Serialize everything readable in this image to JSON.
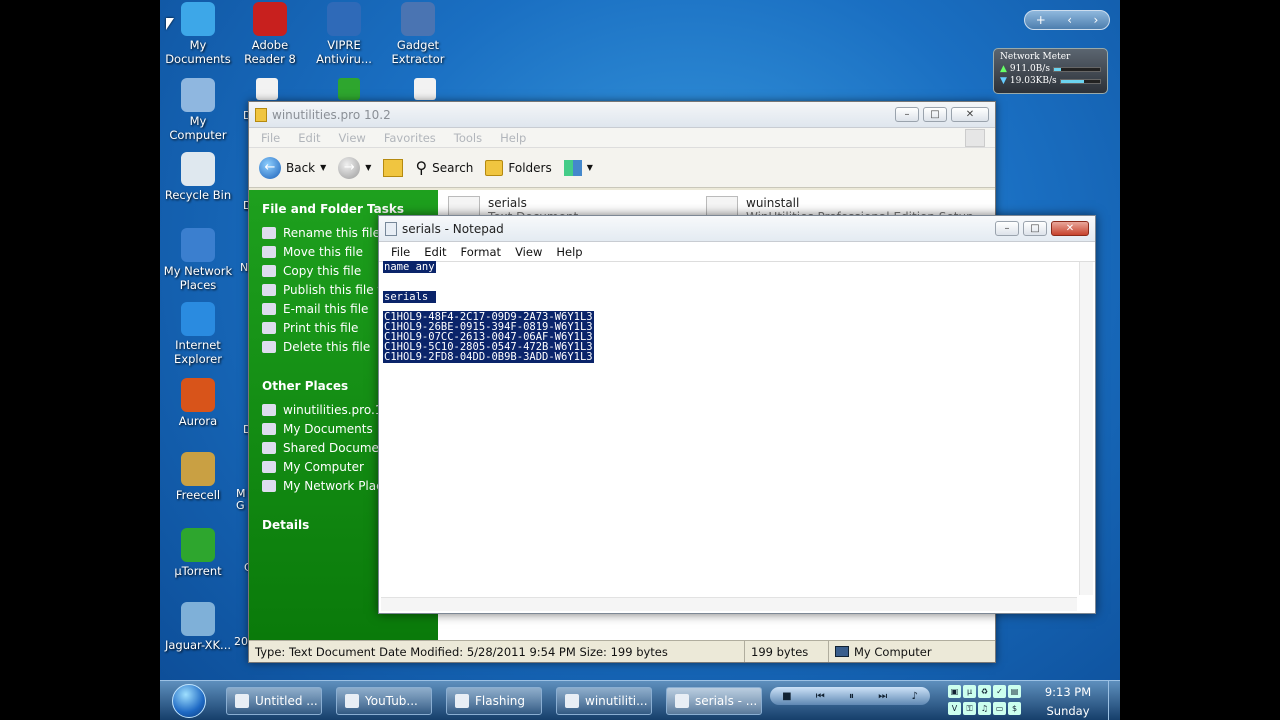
{
  "desktop": {
    "icons": [
      {
        "name": "my-documents",
        "label": "My\nDocuments",
        "color": "#3da7e8"
      },
      {
        "name": "adobe-reader",
        "label": "Adobe\nReader 8",
        "color": "#c8201e"
      },
      {
        "name": "vipre",
        "label": "VIPRE\nAntiviru...",
        "color": "#2f6ab8"
      },
      {
        "name": "gadget-extractor",
        "label": "Gadget\nExtractor",
        "color": "#4a74b2"
      },
      {
        "name": "my-computer",
        "label": "My Computer",
        "color": "#8fb7e0"
      },
      {
        "name": "recycle-bin",
        "label": "Recycle Bin",
        "color": "#dfe8ef"
      },
      {
        "name": "my-network-places",
        "label": "My Network\nPlaces",
        "color": "#3b7fcf"
      },
      {
        "name": "internet-explorer",
        "label": "Internet\nExplorer",
        "color": "#2a8be0"
      },
      {
        "name": "aurora",
        "label": "Aurora",
        "color": "#d8541a"
      },
      {
        "name": "freecell",
        "label": "Freecell",
        "color": "#c9a043"
      },
      {
        "name": "utorrent",
        "label": "µTorrent",
        "color": "#2ea62e"
      },
      {
        "name": "jaguar",
        "label": "Jaguar-XK...",
        "color": "#7fb0d8"
      }
    ],
    "partial_labels": [
      "D",
      "D",
      "D",
      "N",
      "D",
      "M\nG",
      "C",
      "20"
    ]
  },
  "gadget": {
    "title": "Network Meter",
    "up": "911.0B/s",
    "down": "19.03KB/s",
    "up_level": 0.15,
    "down_level": 0.6
  },
  "explorer": {
    "title": "winutilities.pro 10.2",
    "menu": [
      "File",
      "Edit",
      "View",
      "Favorites",
      "Tools",
      "Help"
    ],
    "toolbar": {
      "back": "Back",
      "search": "Search",
      "folders": "Folders"
    },
    "file_tasks_title": "File and Folder Tasks",
    "file_tasks": [
      "Rename this file",
      "Move this file",
      "Copy this file",
      "Publish this file to Web",
      "E-mail this file",
      "Print this file",
      "Delete this file"
    ],
    "other_places_title": "Other Places",
    "other_places": [
      "winutilities.pro.10.",
      "My Documents",
      "Shared Document",
      "My Computer",
      "My Network Places"
    ],
    "details_title": "Details",
    "files": [
      {
        "name": "serials",
        "type": "Text Document"
      },
      {
        "name": "wuinstall",
        "type": "WinUtilities Professional Edition Setup"
      }
    ],
    "status": {
      "info": "Type: Text Document Date Modified: 5/28/2011 9:54 PM Size: 199 bytes",
      "size": "199 bytes",
      "location": "My Computer"
    }
  },
  "notepad": {
    "title": "serials - Notepad",
    "menu": [
      "File",
      "Edit",
      "Format",
      "View",
      "Help"
    ],
    "lines": [
      "name any",
      "",
      "",
      "serials ",
      "",
      "C1HOL9-48F4-2C17-09D9-2A73-W6Y1L3",
      "C1HOL9-26BE-0915-394F-0819-W6Y1L3",
      "C1HOL9-07CC-2613-0047-06AF-W6Y1L3",
      "C1HOL9-5C10-2805-0547-472B-W6Y1L3",
      "C1HOL9-2FD8-04DD-0B9B-3ADD-W6Y1L3"
    ]
  },
  "taskbar": {
    "tasks": [
      {
        "label": "Untitled ...",
        "active": false
      },
      {
        "label": "YouTub...",
        "active": false
      },
      {
        "label": "Flashing",
        "active": false
      },
      {
        "label": "winutiliti...",
        "active": false
      },
      {
        "label": "serials - ...",
        "active": true
      }
    ],
    "time": "9:13 PM",
    "day": "Sunday"
  }
}
